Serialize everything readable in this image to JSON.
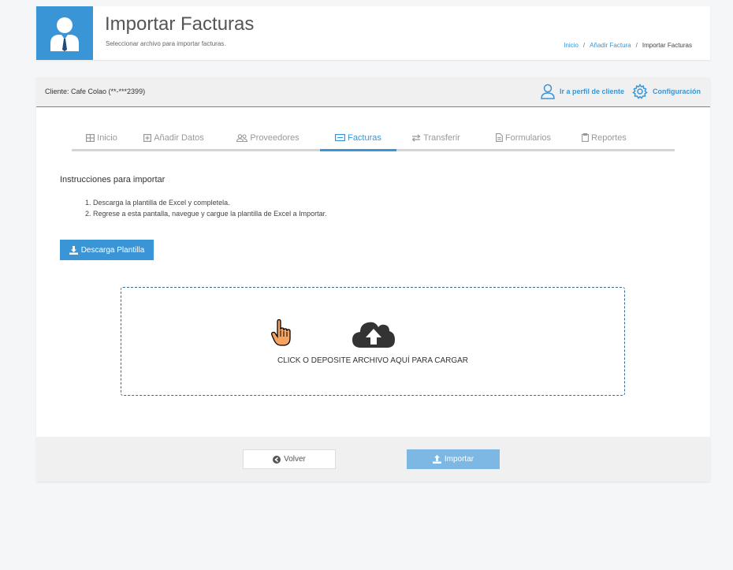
{
  "header": {
    "title": "Importar Facturas",
    "subtitle": "Seleccionar archivo para importar facturas.",
    "breadcrumb": {
      "items": [
        "Inicio",
        "Añadir Factura",
        "Importar Facturas"
      ],
      "separator": "/"
    }
  },
  "client_bar": {
    "client_label": "Cliente: Cafe Colao (**-***2399)",
    "profile_link": "Ir a perfil de cliente",
    "config_link": "Configuración"
  },
  "tabs": [
    {
      "label": "Inicio",
      "icon": "grid-icon"
    },
    {
      "label": "Añadir Datos",
      "icon": "plus-square-icon"
    },
    {
      "label": "Proveedores",
      "icon": "users-icon"
    },
    {
      "label": "Facturas",
      "icon": "invoice-icon",
      "active": true
    },
    {
      "label": "Transferir",
      "icon": "transfer-icon"
    },
    {
      "label": "Formularios",
      "icon": "file-icon"
    },
    {
      "label": "Reportes",
      "icon": "clipboard-icon"
    }
  ],
  "instructions": {
    "title": "Instrucciones para importar",
    "steps": [
      "1. Descarga la plantilla de Excel y completela.",
      "2. Regrese a esta pantalla, navegue y cargue la plantilla de Excel a Importar."
    ]
  },
  "download_button": "Descarga Plantilla",
  "dropzone": {
    "text": "CLICK O DEPOSITE ARCHIVO AQUÍ PARA CARGAR"
  },
  "footer": {
    "back_label": "Volver",
    "import_label": "Importar"
  },
  "colors": {
    "accent": "#3a95d6",
    "import_disabled": "#7cb8e3"
  }
}
